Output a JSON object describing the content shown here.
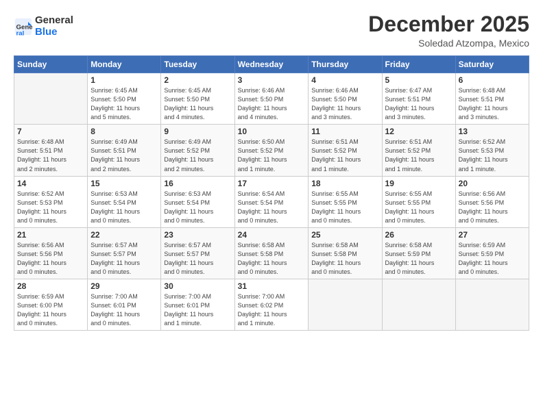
{
  "header": {
    "logo_line1": "General",
    "logo_line2": "Blue",
    "month": "December 2025",
    "location": "Soledad Atzompa, Mexico"
  },
  "weekdays": [
    "Sunday",
    "Monday",
    "Tuesday",
    "Wednesday",
    "Thursday",
    "Friday",
    "Saturday"
  ],
  "weeks": [
    [
      {
        "day": "",
        "info": ""
      },
      {
        "day": "1",
        "info": "Sunrise: 6:45 AM\nSunset: 5:50 PM\nDaylight: 11 hours\nand 5 minutes."
      },
      {
        "day": "2",
        "info": "Sunrise: 6:45 AM\nSunset: 5:50 PM\nDaylight: 11 hours\nand 4 minutes."
      },
      {
        "day": "3",
        "info": "Sunrise: 6:46 AM\nSunset: 5:50 PM\nDaylight: 11 hours\nand 4 minutes."
      },
      {
        "day": "4",
        "info": "Sunrise: 6:46 AM\nSunset: 5:50 PM\nDaylight: 11 hours\nand 3 minutes."
      },
      {
        "day": "5",
        "info": "Sunrise: 6:47 AM\nSunset: 5:51 PM\nDaylight: 11 hours\nand 3 minutes."
      },
      {
        "day": "6",
        "info": "Sunrise: 6:48 AM\nSunset: 5:51 PM\nDaylight: 11 hours\nand 3 minutes."
      }
    ],
    [
      {
        "day": "7",
        "info": "Sunrise: 6:48 AM\nSunset: 5:51 PM\nDaylight: 11 hours\nand 2 minutes."
      },
      {
        "day": "8",
        "info": "Sunrise: 6:49 AM\nSunset: 5:51 PM\nDaylight: 11 hours\nand 2 minutes."
      },
      {
        "day": "9",
        "info": "Sunrise: 6:49 AM\nSunset: 5:52 PM\nDaylight: 11 hours\nand 2 minutes."
      },
      {
        "day": "10",
        "info": "Sunrise: 6:50 AM\nSunset: 5:52 PM\nDaylight: 11 hours\nand 1 minute."
      },
      {
        "day": "11",
        "info": "Sunrise: 6:51 AM\nSunset: 5:52 PM\nDaylight: 11 hours\nand 1 minute."
      },
      {
        "day": "12",
        "info": "Sunrise: 6:51 AM\nSunset: 5:52 PM\nDaylight: 11 hours\nand 1 minute."
      },
      {
        "day": "13",
        "info": "Sunrise: 6:52 AM\nSunset: 5:53 PM\nDaylight: 11 hours\nand 1 minute."
      }
    ],
    [
      {
        "day": "14",
        "info": "Sunrise: 6:52 AM\nSunset: 5:53 PM\nDaylight: 11 hours\nand 0 minutes."
      },
      {
        "day": "15",
        "info": "Sunrise: 6:53 AM\nSunset: 5:54 PM\nDaylight: 11 hours\nand 0 minutes."
      },
      {
        "day": "16",
        "info": "Sunrise: 6:53 AM\nSunset: 5:54 PM\nDaylight: 11 hours\nand 0 minutes."
      },
      {
        "day": "17",
        "info": "Sunrise: 6:54 AM\nSunset: 5:54 PM\nDaylight: 11 hours\nand 0 minutes."
      },
      {
        "day": "18",
        "info": "Sunrise: 6:55 AM\nSunset: 5:55 PM\nDaylight: 11 hours\nand 0 minutes."
      },
      {
        "day": "19",
        "info": "Sunrise: 6:55 AM\nSunset: 5:55 PM\nDaylight: 11 hours\nand 0 minutes."
      },
      {
        "day": "20",
        "info": "Sunrise: 6:56 AM\nSunset: 5:56 PM\nDaylight: 11 hours\nand 0 minutes."
      }
    ],
    [
      {
        "day": "21",
        "info": "Sunrise: 6:56 AM\nSunset: 5:56 PM\nDaylight: 11 hours\nand 0 minutes."
      },
      {
        "day": "22",
        "info": "Sunrise: 6:57 AM\nSunset: 5:57 PM\nDaylight: 11 hours\nand 0 minutes."
      },
      {
        "day": "23",
        "info": "Sunrise: 6:57 AM\nSunset: 5:57 PM\nDaylight: 11 hours\nand 0 minutes."
      },
      {
        "day": "24",
        "info": "Sunrise: 6:58 AM\nSunset: 5:58 PM\nDaylight: 11 hours\nand 0 minutes."
      },
      {
        "day": "25",
        "info": "Sunrise: 6:58 AM\nSunset: 5:58 PM\nDaylight: 11 hours\nand 0 minutes."
      },
      {
        "day": "26",
        "info": "Sunrise: 6:58 AM\nSunset: 5:59 PM\nDaylight: 11 hours\nand 0 minutes."
      },
      {
        "day": "27",
        "info": "Sunrise: 6:59 AM\nSunset: 5:59 PM\nDaylight: 11 hours\nand 0 minutes."
      }
    ],
    [
      {
        "day": "28",
        "info": "Sunrise: 6:59 AM\nSunset: 6:00 PM\nDaylight: 11 hours\nand 0 minutes."
      },
      {
        "day": "29",
        "info": "Sunrise: 7:00 AM\nSunset: 6:01 PM\nDaylight: 11 hours\nand 0 minutes."
      },
      {
        "day": "30",
        "info": "Sunrise: 7:00 AM\nSunset: 6:01 PM\nDaylight: 11 hours\nand 1 minute."
      },
      {
        "day": "31",
        "info": "Sunrise: 7:00 AM\nSunset: 6:02 PM\nDaylight: 11 hours\nand 1 minute."
      },
      {
        "day": "",
        "info": ""
      },
      {
        "day": "",
        "info": ""
      },
      {
        "day": "",
        "info": ""
      }
    ]
  ]
}
